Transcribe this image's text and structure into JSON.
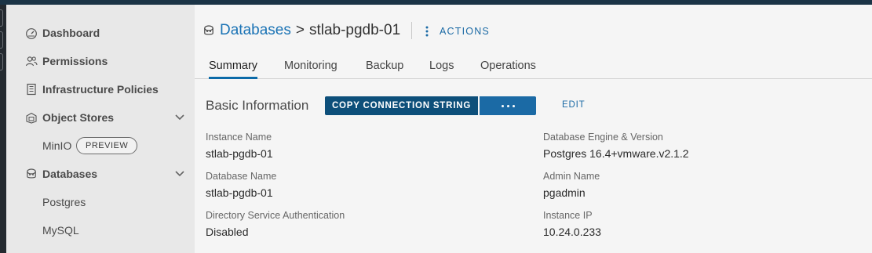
{
  "sidebar": {
    "items": [
      {
        "label": "Dashboard",
        "icon": "dashboard-icon"
      },
      {
        "label": "Permissions",
        "icon": "users-icon"
      },
      {
        "label": "Infrastructure Policies",
        "icon": "building-icon"
      },
      {
        "label": "Object Stores",
        "icon": "object-store-icon"
      },
      {
        "label": "MinIO",
        "badge": "PREVIEW"
      },
      {
        "label": "Databases",
        "icon": "database-icon"
      },
      {
        "label": "Postgres"
      },
      {
        "label": "MySQL"
      }
    ]
  },
  "header": {
    "breadcrumb_link": "Databases",
    "breadcrumb_sep": ">",
    "current": "stlab-pgdb-01",
    "actions_label": "ACTIONS"
  },
  "tabs": [
    "Summary",
    "Monitoring",
    "Backup",
    "Logs",
    "Operations"
  ],
  "active_tab": "Summary",
  "basic": {
    "title": "Basic Information",
    "copy_label": "COPY CONNECTION STRING",
    "edit_label": "EDIT",
    "fields": [
      {
        "key": "Instance Name",
        "value": "stlab-pgdb-01"
      },
      {
        "key": "Database Engine & Version",
        "value": "Postgres 16.4+vmware.v2.1.2"
      },
      {
        "key": "Database Name",
        "value": "stlab-pgdb-01"
      },
      {
        "key": "Admin Name",
        "value": "pgadmin"
      },
      {
        "key": "Directory Service Authentication",
        "value": "Disabled"
      },
      {
        "key": "Instance IP",
        "value": "10.24.0.233"
      }
    ]
  },
  "colors": {
    "accent": "#1b6aa5",
    "primary_button": "#0d4f7a",
    "topbar": "#1b3446",
    "sidebar_bg": "#e8e8e8"
  }
}
